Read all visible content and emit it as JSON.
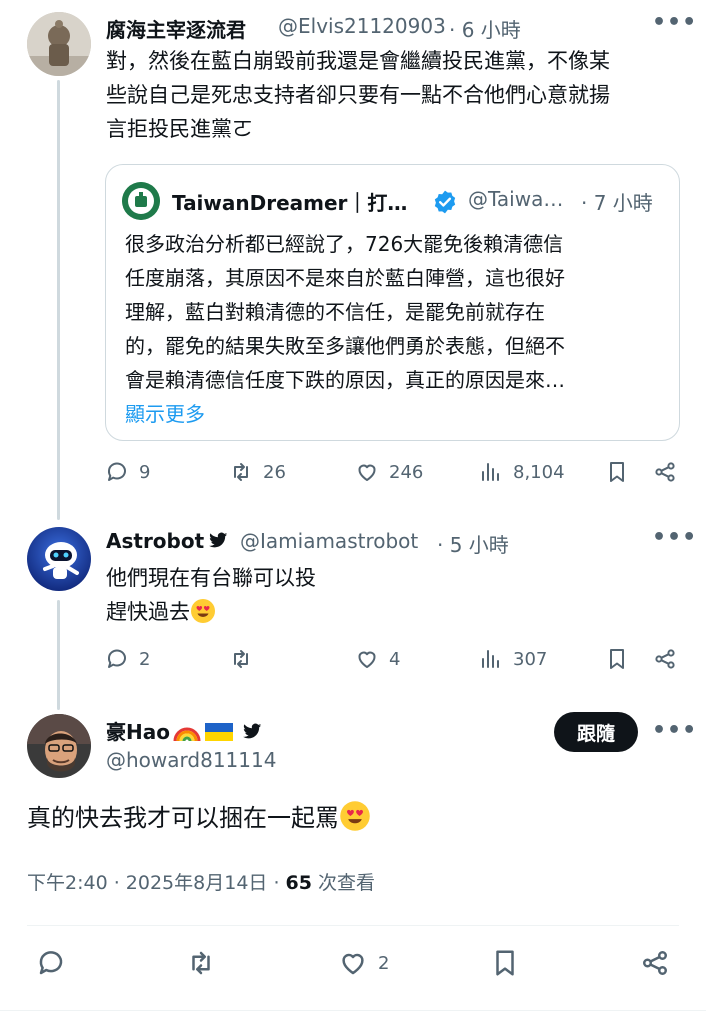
{
  "tweet1": {
    "name": "腐海主宰逐流君",
    "handle": "@Elvis21120903",
    "time": "· 6 小時",
    "lines": [
      "對，然後在藍白崩毀前我還是會繼續投民進黨，不像某",
      "些說自己是死忠支持者卻只要有一點不合他們心意就揚",
      "言拒投民進黨ㄛ"
    ],
    "quote": {
      "name": "TaiwanDreamer｜打…",
      "handle": "@Taiwa…",
      "time": "· 7 小時",
      "lines": [
        "很多政治分析都已經說了，726大罷免後賴清德信",
        "任度崩落，其原因不是來自於藍白陣營，這也很好",
        "理解，藍白對賴清德的不信任，是罷免前就存在",
        "的，罷免的結果失敗至多讓他們勇於表態，但絕不",
        "會是賴清德信任度下跌的原因，真正的原因是來…"
      ],
      "show_more": "顯示更多"
    },
    "actions": {
      "reply": "9",
      "retweet": "26",
      "like": "246",
      "views": "8,104"
    }
  },
  "tweet2": {
    "name": "Astrobot",
    "handle": "@Iamiamastrobot",
    "time": "· 5 小時",
    "line1": "他們現在有台聯可以投",
    "line2": "趕快過去",
    "actions": {
      "reply": "2",
      "retweet": "",
      "like": "4",
      "views": "307"
    }
  },
  "tweet3": {
    "name": "豪Hao",
    "handle": "@howard811114",
    "follow_label": "跟隨",
    "text": "真的快去我才可以捆在一起罵",
    "timestamp": "下午2:40 · 2025年8月14日 · ",
    "views_count": "65",
    "views_label": " 次查看",
    "actions": {
      "like": "2"
    }
  },
  "colors": {
    "accent": "#1d9bf0",
    "verified_badge": "#1d9bf0",
    "muted": "#536471"
  },
  "icons": [
    "reply-icon",
    "retweet-icon",
    "like-icon",
    "views-icon",
    "bookmark-icon",
    "share-icon",
    "more-icon",
    "verified-badge-icon",
    "bird-icon",
    "rainbow-flag-icon",
    "ukraine-flag-icon",
    "heart-eyes-emoji-icon"
  ]
}
